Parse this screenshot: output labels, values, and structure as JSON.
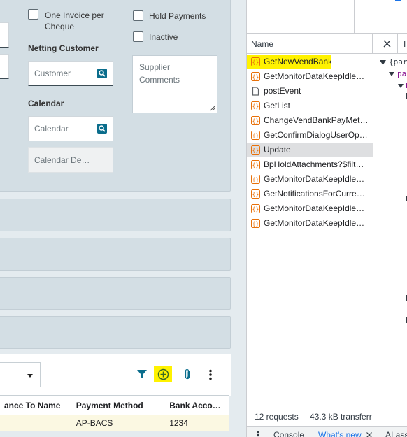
{
  "form": {
    "one_invoice_label": "One Invoice per Cheque",
    "hold_payments_label": "Hold Payments",
    "inactive_label": "Inactive",
    "netting_customer_label": "Netting Customer",
    "customer_placeholder": "Customer",
    "calendar_label": "Calendar",
    "calendar_placeholder": "Calendar",
    "calendar_desc_placeholder": "Calendar De…",
    "supplier_comments_placeholder": "Supplier Comments"
  },
  "grid": {
    "columns": [
      "ance To Name",
      "Payment Method",
      "Bank Acco…"
    ],
    "rows": [
      [
        "",
        "AP-BACS",
        "1234"
      ]
    ]
  },
  "devtools": {
    "name_header": "Name",
    "requests": [
      {
        "name": "GetNewVendBank",
        "type": "xhr",
        "highlight": true
      },
      {
        "name": "GetMonitorDataKeepIdleTi…",
        "type": "xhr"
      },
      {
        "name": "postEvent",
        "type": "doc"
      },
      {
        "name": "GetList",
        "type": "xhr"
      },
      {
        "name": "ChangeVendBankPayMeth…",
        "type": "xhr"
      },
      {
        "name": "GetConfirmDialogUserOpti…",
        "type": "xhr"
      },
      {
        "name": "Update",
        "type": "xhr",
        "selected": true
      },
      {
        "name": "BpHoldAttachments?$filter…",
        "type": "xhr"
      },
      {
        "name": "GetMonitorDataKeepIdleTi…",
        "type": "xhr"
      },
      {
        "name": "GetNotificationsForCurrent…",
        "type": "xhr"
      },
      {
        "name": "GetMonitorDataKeepIdleTi…",
        "type": "xhr"
      },
      {
        "name": "GetMonitorDataKeepIdleTi…",
        "type": "xhr"
      }
    ],
    "requests_count": "12 requests",
    "transferred": "43.3 kB transferr",
    "preview_line1": "{par",
    "preview_line2": "pa",
    "console_tab": "Console",
    "whats_new_tab": "What's new",
    "ai_tab": "AI ass"
  },
  "colors": {
    "highlight": "#fff200",
    "accent": "#1a73e8",
    "teal": "#0a6d8c"
  }
}
